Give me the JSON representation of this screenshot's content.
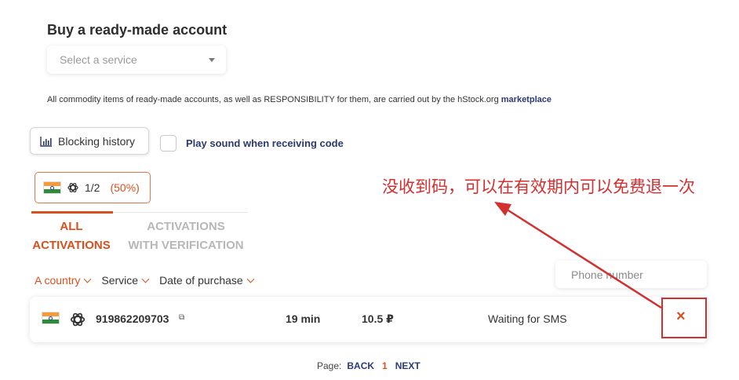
{
  "buy_section": {
    "title": "Buy a ready-made account",
    "service_select_placeholder": "Select a service",
    "notice_text": "All commodity items of ready-made accounts, as well as RESPONSIBILITY for them, are carried out by the hStock.org ",
    "notice_link": "marketplace"
  },
  "controls": {
    "blocking_history_label": "Blocking history",
    "play_sound_label": "Play sound when receiving code"
  },
  "stats_badge": {
    "country_flag": "india-flag",
    "service_icon": "openai-icon",
    "count": "1/2",
    "percent": "(50%)"
  },
  "annotation": {
    "text": "没收到码，可以在有效期内可以免费退一次",
    "color": "#d32f2f"
  },
  "tabs": [
    {
      "line1": "ALL",
      "line2": "ACTIVATIONS",
      "active": true
    },
    {
      "line1": "ACTIVATIONS",
      "line2": "WITH VERIFICATION",
      "active": false
    }
  ],
  "filters": {
    "country": "A country",
    "service": "Service",
    "date": "Date of purchase"
  },
  "phone_search_placeholder": "Phone number",
  "activations": [
    {
      "country_flag": "india-flag",
      "service_icon": "openai-icon",
      "phone": "919862209703",
      "copy_icon": "copy-icon",
      "time_left": "19 min",
      "price": "10.5 ₽",
      "status": "Waiting for SMS",
      "cancel_icon": "×"
    }
  ],
  "pagination": {
    "label": "Page:",
    "back": "BACK",
    "current": "1",
    "next": "NEXT"
  },
  "colors": {
    "accent": "#d9501f",
    "link": "#2b3a7a",
    "annotation_red": "#d32f2f"
  }
}
